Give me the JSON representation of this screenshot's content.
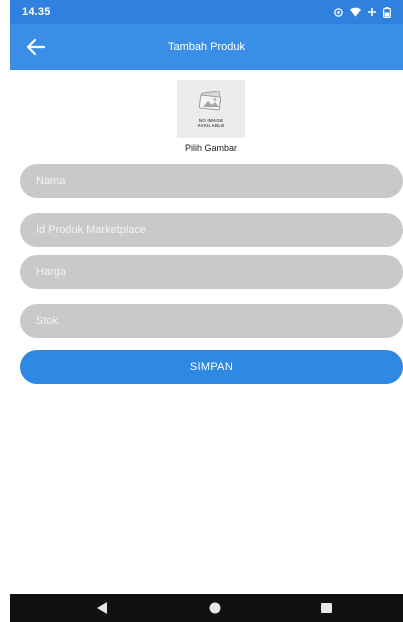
{
  "status_bar": {
    "time": "14.35",
    "icons": [
      "cast-icon",
      "wifi-icon",
      "signal-icon",
      "battery-icon"
    ]
  },
  "app_bar": {
    "title": "Tambah Produk",
    "back_icon": "arrow-left-icon"
  },
  "image_picker": {
    "placeholder_text": "NO IMAGE AVAILABLE",
    "label": "Pilih Gambar"
  },
  "form": {
    "fields": [
      {
        "placeholder": "Nama",
        "value": ""
      },
      {
        "placeholder": "Id Produk Marketplace",
        "value": ""
      },
      {
        "placeholder": "Harga",
        "value": ""
      },
      {
        "placeholder": "Stok",
        "value": ""
      }
    ],
    "submit_label": "SIMPAN"
  },
  "nav_bar": {
    "icons": [
      "nav-back-icon",
      "nav-home-icon",
      "nav-recent-icon"
    ]
  },
  "colors": {
    "status_bar": "#2f80df",
    "app_bar": "#3b8ee6",
    "field_bg": "#c9c9c9",
    "button": "#2f88e2",
    "nav_bar": "#101010"
  }
}
